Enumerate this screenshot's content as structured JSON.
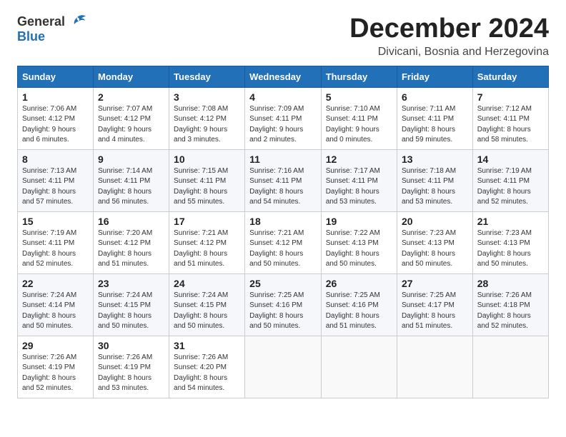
{
  "logo": {
    "general": "General",
    "blue": "Blue"
  },
  "title": "December 2024",
  "subtitle": "Divicani, Bosnia and Herzegovina",
  "days_of_week": [
    "Sunday",
    "Monday",
    "Tuesday",
    "Wednesday",
    "Thursday",
    "Friday",
    "Saturday"
  ],
  "weeks": [
    [
      {
        "day": "1",
        "sunrise": "Sunrise: 7:06 AM",
        "sunset": "Sunset: 4:12 PM",
        "daylight": "Daylight: 9 hours and 6 minutes."
      },
      {
        "day": "2",
        "sunrise": "Sunrise: 7:07 AM",
        "sunset": "Sunset: 4:12 PM",
        "daylight": "Daylight: 9 hours and 4 minutes."
      },
      {
        "day": "3",
        "sunrise": "Sunrise: 7:08 AM",
        "sunset": "Sunset: 4:12 PM",
        "daylight": "Daylight: 9 hours and 3 minutes."
      },
      {
        "day": "4",
        "sunrise": "Sunrise: 7:09 AM",
        "sunset": "Sunset: 4:11 PM",
        "daylight": "Daylight: 9 hours and 2 minutes."
      },
      {
        "day": "5",
        "sunrise": "Sunrise: 7:10 AM",
        "sunset": "Sunset: 4:11 PM",
        "daylight": "Daylight: 9 hours and 0 minutes."
      },
      {
        "day": "6",
        "sunrise": "Sunrise: 7:11 AM",
        "sunset": "Sunset: 4:11 PM",
        "daylight": "Daylight: 8 hours and 59 minutes."
      },
      {
        "day": "7",
        "sunrise": "Sunrise: 7:12 AM",
        "sunset": "Sunset: 4:11 PM",
        "daylight": "Daylight: 8 hours and 58 minutes."
      }
    ],
    [
      {
        "day": "8",
        "sunrise": "Sunrise: 7:13 AM",
        "sunset": "Sunset: 4:11 PM",
        "daylight": "Daylight: 8 hours and 57 minutes."
      },
      {
        "day": "9",
        "sunrise": "Sunrise: 7:14 AM",
        "sunset": "Sunset: 4:11 PM",
        "daylight": "Daylight: 8 hours and 56 minutes."
      },
      {
        "day": "10",
        "sunrise": "Sunrise: 7:15 AM",
        "sunset": "Sunset: 4:11 PM",
        "daylight": "Daylight: 8 hours and 55 minutes."
      },
      {
        "day": "11",
        "sunrise": "Sunrise: 7:16 AM",
        "sunset": "Sunset: 4:11 PM",
        "daylight": "Daylight: 8 hours and 54 minutes."
      },
      {
        "day": "12",
        "sunrise": "Sunrise: 7:17 AM",
        "sunset": "Sunset: 4:11 PM",
        "daylight": "Daylight: 8 hours and 53 minutes."
      },
      {
        "day": "13",
        "sunrise": "Sunrise: 7:18 AM",
        "sunset": "Sunset: 4:11 PM",
        "daylight": "Daylight: 8 hours and 53 minutes."
      },
      {
        "day": "14",
        "sunrise": "Sunrise: 7:19 AM",
        "sunset": "Sunset: 4:11 PM",
        "daylight": "Daylight: 8 hours and 52 minutes."
      }
    ],
    [
      {
        "day": "15",
        "sunrise": "Sunrise: 7:19 AM",
        "sunset": "Sunset: 4:11 PM",
        "daylight": "Daylight: 8 hours and 52 minutes."
      },
      {
        "day": "16",
        "sunrise": "Sunrise: 7:20 AM",
        "sunset": "Sunset: 4:12 PM",
        "daylight": "Daylight: 8 hours and 51 minutes."
      },
      {
        "day": "17",
        "sunrise": "Sunrise: 7:21 AM",
        "sunset": "Sunset: 4:12 PM",
        "daylight": "Daylight: 8 hours and 51 minutes."
      },
      {
        "day": "18",
        "sunrise": "Sunrise: 7:21 AM",
        "sunset": "Sunset: 4:12 PM",
        "daylight": "Daylight: 8 hours and 50 minutes."
      },
      {
        "day": "19",
        "sunrise": "Sunrise: 7:22 AM",
        "sunset": "Sunset: 4:13 PM",
        "daylight": "Daylight: 8 hours and 50 minutes."
      },
      {
        "day": "20",
        "sunrise": "Sunrise: 7:23 AM",
        "sunset": "Sunset: 4:13 PM",
        "daylight": "Daylight: 8 hours and 50 minutes."
      },
      {
        "day": "21",
        "sunrise": "Sunrise: 7:23 AM",
        "sunset": "Sunset: 4:13 PM",
        "daylight": "Daylight: 8 hours and 50 minutes."
      }
    ],
    [
      {
        "day": "22",
        "sunrise": "Sunrise: 7:24 AM",
        "sunset": "Sunset: 4:14 PM",
        "daylight": "Daylight: 8 hours and 50 minutes."
      },
      {
        "day": "23",
        "sunrise": "Sunrise: 7:24 AM",
        "sunset": "Sunset: 4:15 PM",
        "daylight": "Daylight: 8 hours and 50 minutes."
      },
      {
        "day": "24",
        "sunrise": "Sunrise: 7:24 AM",
        "sunset": "Sunset: 4:15 PM",
        "daylight": "Daylight: 8 hours and 50 minutes."
      },
      {
        "day": "25",
        "sunrise": "Sunrise: 7:25 AM",
        "sunset": "Sunset: 4:16 PM",
        "daylight": "Daylight: 8 hours and 50 minutes."
      },
      {
        "day": "26",
        "sunrise": "Sunrise: 7:25 AM",
        "sunset": "Sunset: 4:16 PM",
        "daylight": "Daylight: 8 hours and 51 minutes."
      },
      {
        "day": "27",
        "sunrise": "Sunrise: 7:25 AM",
        "sunset": "Sunset: 4:17 PM",
        "daylight": "Daylight: 8 hours and 51 minutes."
      },
      {
        "day": "28",
        "sunrise": "Sunrise: 7:26 AM",
        "sunset": "Sunset: 4:18 PM",
        "daylight": "Daylight: 8 hours and 52 minutes."
      }
    ],
    [
      {
        "day": "29",
        "sunrise": "Sunrise: 7:26 AM",
        "sunset": "Sunset: 4:19 PM",
        "daylight": "Daylight: 8 hours and 52 minutes."
      },
      {
        "day": "30",
        "sunrise": "Sunrise: 7:26 AM",
        "sunset": "Sunset: 4:19 PM",
        "daylight": "Daylight: 8 hours and 53 minutes."
      },
      {
        "day": "31",
        "sunrise": "Sunrise: 7:26 AM",
        "sunset": "Sunset: 4:20 PM",
        "daylight": "Daylight: 8 hours and 54 minutes."
      },
      null,
      null,
      null,
      null
    ]
  ]
}
